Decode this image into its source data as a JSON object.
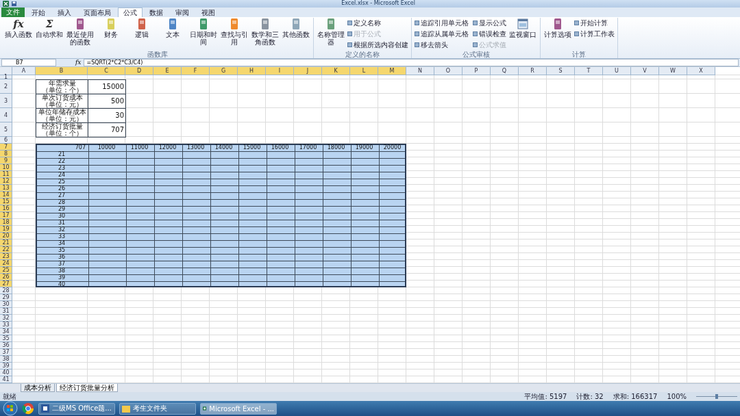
{
  "title_bar": {
    "title": "Excel.xlsx - Microsoft Excel"
  },
  "ribbon_tabs": [
    {
      "label": "文件",
      "kind": "file",
      "selected": false
    },
    {
      "label": "开始",
      "kind": "tab",
      "selected": false
    },
    {
      "label": "插入",
      "kind": "tab",
      "selected": false
    },
    {
      "label": "页面布局",
      "kind": "tab",
      "selected": false
    },
    {
      "label": "公式",
      "kind": "tab",
      "selected": true
    },
    {
      "label": "数据",
      "kind": "tab",
      "selected": false
    },
    {
      "label": "审阅",
      "kind": "tab",
      "selected": false
    },
    {
      "label": "视图",
      "kind": "tab",
      "selected": false
    }
  ],
  "ribbon_groups": [
    {
      "label": "函数库",
      "large": [
        {
          "label": "插入函数",
          "glyph": "fx"
        },
        {
          "label": "自动求和",
          "glyph": "Σ"
        },
        {
          "label": "最近使用的函数"
        },
        {
          "label": "财务"
        },
        {
          "label": "逻辑"
        },
        {
          "label": "文本"
        },
        {
          "label": "日期和时间"
        },
        {
          "label": "查找与引用"
        },
        {
          "label": "数学和三角函数"
        },
        {
          "label": "其他函数"
        }
      ]
    },
    {
      "label": "定义的名称",
      "large": [
        {
          "label": "名称管理器"
        }
      ],
      "small": [
        {
          "label": "定义名称",
          "disabled": false
        },
        {
          "label": "用于公式",
          "disabled": true
        },
        {
          "label": "根据所选内容创建",
          "disabled": false
        }
      ]
    },
    {
      "label": "公式审核",
      "small": [
        {
          "label": "追踪引用单元格",
          "disabled": false
        },
        {
          "label": "追踪从属单元格",
          "disabled": false
        },
        {
          "label": "移去箭头",
          "disabled": false
        },
        {
          "label": "显示公式",
          "disabled": false
        },
        {
          "label": "错误检查",
          "disabled": false
        },
        {
          "label": "公式求值",
          "disabled": true
        }
      ],
      "large_after": [
        {
          "label": "监视窗口"
        }
      ]
    },
    {
      "label": "计算",
      "large": [
        {
          "label": "计算选项"
        }
      ],
      "small": [
        {
          "label": "开始计算",
          "disabled": false
        },
        {
          "label": "计算工作表",
          "disabled": false
        }
      ]
    }
  ],
  "formula_bar": {
    "name_box": "B7",
    "fx": "fx",
    "formula": "=SQRT(2*C2*C3/C4)"
  },
  "columns": [
    {
      "label": "A",
      "selected": false
    },
    {
      "label": "B",
      "selected": true
    },
    {
      "label": "C",
      "selected": true
    },
    {
      "label": "D",
      "selected": true
    },
    {
      "label": "E",
      "selected": true
    },
    {
      "label": "F",
      "selected": true
    },
    {
      "label": "G",
      "selected": true
    },
    {
      "label": "H",
      "selected": true
    },
    {
      "label": "I",
      "selected": true
    },
    {
      "label": "J",
      "selected": true
    },
    {
      "label": "K",
      "selected": true
    },
    {
      "label": "L",
      "selected": true
    },
    {
      "label": "M",
      "selected": true
    },
    {
      "label": "N",
      "selected": false
    },
    {
      "label": "O",
      "selected": false
    },
    {
      "label": "P",
      "selected": false
    },
    {
      "label": "Q",
      "selected": false
    },
    {
      "label": "R",
      "selected": false
    },
    {
      "label": "S",
      "selected": false
    },
    {
      "label": "T",
      "selected": false
    },
    {
      "label": "U",
      "selected": false
    },
    {
      "label": "V",
      "selected": false
    },
    {
      "label": "W",
      "selected": false
    },
    {
      "label": "X",
      "selected": false
    }
  ],
  "rows": [
    {
      "label": "1",
      "selected": false
    },
    {
      "label": "2",
      "selected": false
    },
    {
      "label": "3",
      "selected": false
    },
    {
      "label": "4",
      "selected": false
    },
    {
      "label": "5",
      "selected": false
    },
    {
      "label": "6",
      "selected": false
    },
    {
      "label": "7",
      "selected": true
    },
    {
      "label": "8",
      "selected": true
    },
    {
      "label": "9",
      "selected": true
    },
    {
      "label": "10",
      "selected": true
    },
    {
      "label": "11",
      "selected": true
    },
    {
      "label": "12",
      "selected": true
    },
    {
      "label": "13",
      "selected": true
    },
    {
      "label": "14",
      "selected": true
    },
    {
      "label": "15",
      "selected": true
    },
    {
      "label": "16",
      "selected": true
    },
    {
      "label": "17",
      "selected": true
    },
    {
      "label": "18",
      "selected": true
    },
    {
      "label": "19",
      "selected": true
    },
    {
      "label": "20",
      "selected": true
    },
    {
      "label": "21",
      "selected": true
    },
    {
      "label": "22",
      "selected": true
    },
    {
      "label": "23",
      "selected": true
    },
    {
      "label": "24",
      "selected": true
    },
    {
      "label": "25",
      "selected": true
    },
    {
      "label": "26",
      "selected": true
    },
    {
      "label": "27",
      "selected": true
    },
    {
      "label": "28",
      "selected": false
    },
    {
      "label": "29",
      "selected": false
    },
    {
      "label": "30",
      "selected": false
    },
    {
      "label": "31",
      "selected": false
    },
    {
      "label": "32",
      "selected": false
    },
    {
      "label": "33",
      "selected": false
    },
    {
      "label": "34",
      "selected": false
    },
    {
      "label": "35",
      "selected": false
    },
    {
      "label": "36",
      "selected": false
    },
    {
      "label": "37",
      "selected": false
    },
    {
      "label": "38",
      "selected": false
    },
    {
      "label": "39",
      "selected": false
    },
    {
      "label": "40",
      "selected": false
    },
    {
      "label": "41",
      "selected": false
    }
  ],
  "info_table": [
    {
      "name": "年需求量",
      "unit": "（单位：个）",
      "value": "15000"
    },
    {
      "name": "单次订货成本",
      "unit": "（单位：元）",
      "value": "500"
    },
    {
      "name": "单位年储存成本",
      "unit": "（单位：元）",
      "value": "30"
    },
    {
      "name": "经济订货批量",
      "unit": "（单位：个）",
      "value": "707"
    }
  ],
  "eoq_table": {
    "selected": true,
    "corner": "707",
    "headers": [
      "10000",
      "11000",
      "12000",
      "13000",
      "14000",
      "15000",
      "16000",
      "17000",
      "18000",
      "19000",
      "20000"
    ],
    "row_labels": [
      "21",
      "22",
      "23",
      "24",
      "25",
      "26",
      "27",
      "28",
      "29",
      "30",
      "31",
      "32",
      "33",
      "34",
      "35",
      "36",
      "37",
      "38",
      "39",
      "40"
    ]
  },
  "sheet_tabs": [
    {
      "label": "成本分析",
      "selected": false
    },
    {
      "label": "经济订货批量分析",
      "selected": true
    }
  ],
  "status_bar": {
    "mode": "就绪",
    "average": "平均值: 5197",
    "count": "计数: 32",
    "sum": "求和: 166317",
    "zoom": "100%"
  },
  "taskbar": [
    {
      "label": "二级MS Office题...",
      "kind": "word",
      "selected": false
    },
    {
      "label": "考生文件夹",
      "kind": "folder",
      "selected": false
    },
    {
      "label": "Microsoft Excel - ...",
      "kind": "excel",
      "selected": true
    }
  ]
}
